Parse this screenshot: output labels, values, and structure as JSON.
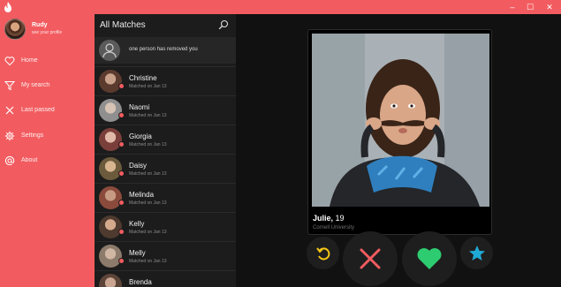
{
  "window": {
    "minimize": "–",
    "maximize": "☐",
    "close": "✕"
  },
  "profile": {
    "name": "Rudy",
    "subtitle": "see your profile"
  },
  "nav": [
    {
      "label": "Home",
      "icon": "heart-icon"
    },
    {
      "label": "My search",
      "icon": "funnel-icon"
    },
    {
      "label": "Last passed",
      "icon": "cross-icon"
    },
    {
      "label": "Settings",
      "icon": "gear-icon"
    },
    {
      "label": "About",
      "icon": "at-icon"
    }
  ],
  "matches": {
    "title": "All Matches",
    "removed_notice": "one person has removed you",
    "items": [
      {
        "name": "Christine",
        "subtitle": "Matched on Jan 13"
      },
      {
        "name": "Naomi",
        "subtitle": "Matched on Jan 13"
      },
      {
        "name": "Giorgia",
        "subtitle": "Matched on Jan 13"
      },
      {
        "name": "Daisy",
        "subtitle": "Matched on Jan 13"
      },
      {
        "name": "Melinda",
        "subtitle": "Matched on Jan 13"
      },
      {
        "name": "Kelly",
        "subtitle": "Matched on Jan 13"
      },
      {
        "name": "Melly",
        "subtitle": "Matched on Jan 13"
      },
      {
        "name": "Brenda",
        "subtitle": ""
      }
    ]
  },
  "card": {
    "name": "Julie,",
    "age": "19",
    "school": "Cornell University"
  },
  "colors": {
    "accent": "#f25c60",
    "like": "#2ecc71",
    "rewind": "#f5c518",
    "super": "#1fa9d6"
  }
}
